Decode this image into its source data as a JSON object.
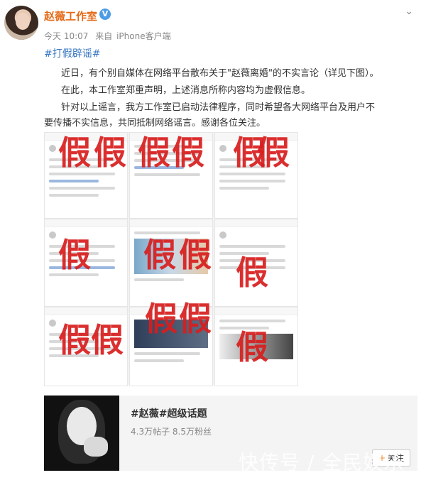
{
  "post": {
    "author": "赵薇工作室",
    "verified_badge": "V",
    "time": "今天 10:07",
    "source_prefix": "来自",
    "source": "iPhone客户端",
    "hashtag": "#打假辟谣#",
    "paragraphs": [
      "近日，有个别自媒体在网络平台散布关于\"赵薇离婚\"的不实言论（详见下图）。",
      "在此，本工作室郑重声明，上述消息所称内容均为虚假信息。",
      "针对以上谣言，我方工作室已启动法律程序，同时希望各大网络平台及用户不",
      "要传播不实信息，共同抵制网络谣言。感谢各位关注。"
    ],
    "fake_stamp": "假"
  },
  "topic_card": {
    "title": "#赵薇#超级话题",
    "stats": "4.3万帖子 8.5万粉丝",
    "follow_label": "关注"
  },
  "watermark": "快传号 / 全民娱乐"
}
